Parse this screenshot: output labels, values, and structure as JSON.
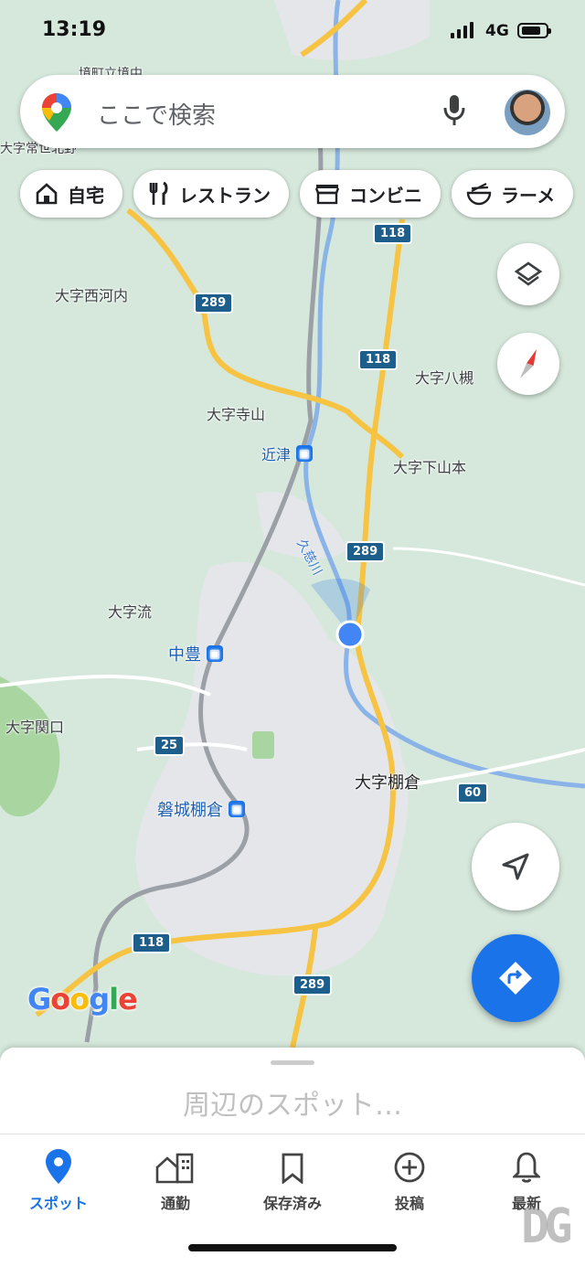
{
  "status_bar": {
    "time": "13:19",
    "network": "4G"
  },
  "search": {
    "placeholder": "ここで検索"
  },
  "chips": [
    {
      "label": "自宅",
      "icon": "home-icon"
    },
    {
      "label": "レストラン",
      "icon": "restaurant-icon"
    },
    {
      "label": "コンビニ",
      "icon": "store-icon"
    },
    {
      "label": "ラーメ",
      "icon": "ramen-icon"
    }
  ],
  "map": {
    "labels": {
      "nishikawauchi": "大字西河内",
      "terayama": "大字寺山",
      "yatsuki": "大字八槻",
      "chikatsu": "近津",
      "shimoyamamoto": "大字下山本",
      "kujigawa": "久慈川",
      "nagare": "大字流",
      "nakatoyo": "中豊",
      "sekiguchi": "大字関口",
      "tanakura": "大字棚倉",
      "iwakitanakura": "磐城棚倉",
      "top_a": "境町立境中",
      "top_b": "大字常世北野"
    },
    "route_shields": [
      "118",
      "289",
      "118",
      "289",
      "25",
      "60",
      "118",
      "289"
    ],
    "brand": "Google"
  },
  "colors": {
    "accent": "#1a73e8",
    "map_green": "#d6e8dc",
    "road_yellow": "#f6c343",
    "urban_gray": "#e4e6ea"
  },
  "sheet": {
    "nearby": "周辺のスポット…"
  },
  "nav": [
    {
      "label": "スポット",
      "icon": "explore-pin-icon",
      "active": true
    },
    {
      "label": "通勤",
      "icon": "commute-icon",
      "active": false
    },
    {
      "label": "保存済み",
      "icon": "bookmark-icon",
      "active": false
    },
    {
      "label": "投稿",
      "icon": "contribute-icon",
      "active": false
    },
    {
      "label": "最新",
      "icon": "bell-icon",
      "active": false
    }
  ]
}
